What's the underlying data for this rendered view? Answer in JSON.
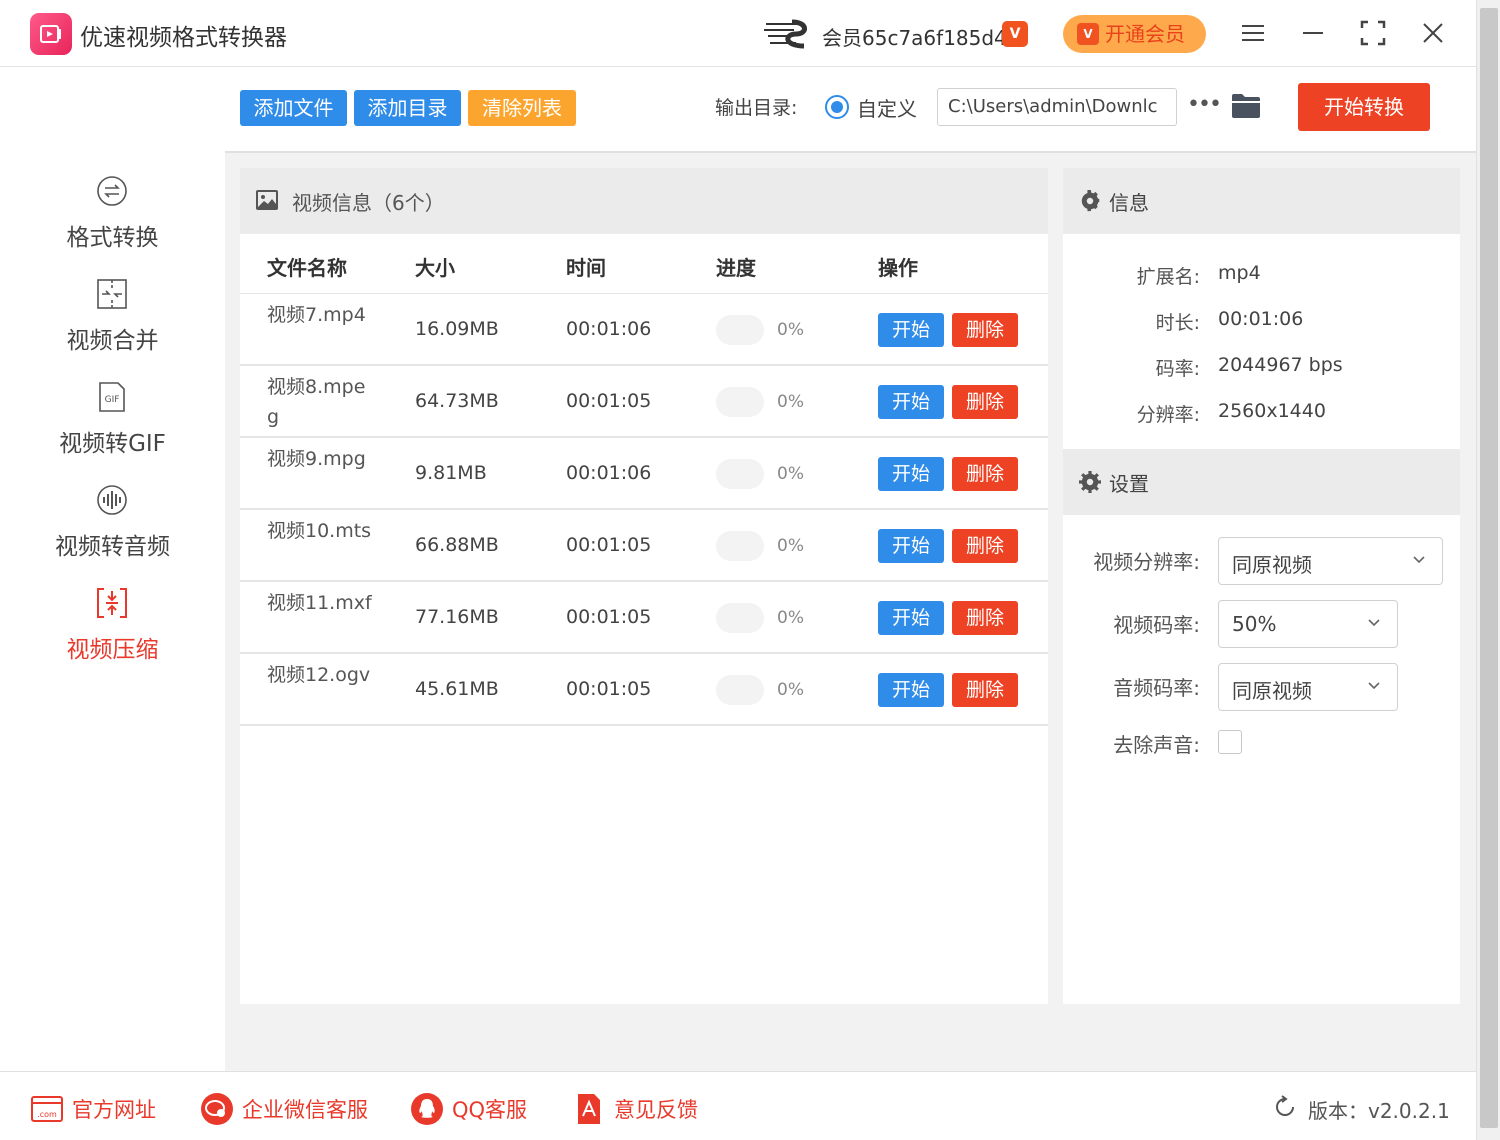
{
  "app": {
    "title": "优速视频格式转换器",
    "user_name": "会员65c7a6f185d4",
    "vip_badge": "V",
    "vip_button": "开通会员",
    "accent_color": "#2f8ce8",
    "danger_color": "#ee4224"
  },
  "sidebar": {
    "items": [
      {
        "label": "格式转换",
        "icon": "format-convert-icon"
      },
      {
        "label": "视频合并",
        "icon": "merge-icon"
      },
      {
        "label": "视频转GIF",
        "icon": "gif-icon"
      },
      {
        "label": "视频转音频",
        "icon": "audio-icon"
      },
      {
        "label": "视频压缩",
        "icon": "compress-icon",
        "active": true
      }
    ]
  },
  "toolbar": {
    "add_file": "添加文件",
    "add_dir": "添加目录",
    "clear_list": "清除列表",
    "output_label": "输出目录:",
    "custom_label": "自定义",
    "output_path": "C:\\Users\\admin\\Downlc",
    "more": "•••",
    "start_convert": "开始转换"
  },
  "video_list": {
    "title": "视频信息（6个）",
    "columns": [
      "文件名称",
      "大小",
      "时间",
      "进度",
      "操作"
    ],
    "start_label": "开始",
    "delete_label": "删除",
    "rows": [
      {
        "name": "视频7.mp4",
        "size": "16.09MB",
        "time": "00:01:06",
        "progress": "0%",
        "progress_value": 0
      },
      {
        "name": "视频8.mpeg",
        "size": "64.73MB",
        "time": "00:01:05",
        "progress": "0%",
        "progress_value": 0
      },
      {
        "name": "视频9.mpg",
        "size": "9.81MB",
        "time": "00:01:06",
        "progress": "0%",
        "progress_value": 0
      },
      {
        "name": "视频10.mts",
        "size": "66.88MB",
        "time": "00:01:05",
        "progress": "0%",
        "progress_value": 0
      },
      {
        "name": "视频11.mxf",
        "size": "77.16MB",
        "time": "00:01:05",
        "progress": "0%",
        "progress_value": 0
      },
      {
        "name": "视频12.ogv",
        "size": "45.61MB",
        "time": "00:01:05",
        "progress": "0%",
        "progress_value": 0
      }
    ]
  },
  "info": {
    "title": "信息",
    "ext_label": "扩展名:",
    "ext_value": "mp4",
    "duration_label": "时长:",
    "duration_value": "00:01:06",
    "bitrate_label": "码率:",
    "bitrate_value": "2044967 bps",
    "resolution_label": "分辨率:",
    "resolution_value": "2560x1440"
  },
  "settings": {
    "title": "设置",
    "video_res_label": "视频分辨率:",
    "video_res_value": "同原视频",
    "video_bitrate_label": "视频码率:",
    "video_bitrate_value": "50%",
    "audio_bitrate_label": "音频码率:",
    "audio_bitrate_value": "同原视频",
    "remove_audio_label": "去除声音:",
    "remove_audio_checked": false
  },
  "footer": {
    "website": "官方网址",
    "wechat": "企业微信客服",
    "qq": "QQ客服",
    "feedback": "意见反馈",
    "version": "版本：v2.0.2.1"
  }
}
